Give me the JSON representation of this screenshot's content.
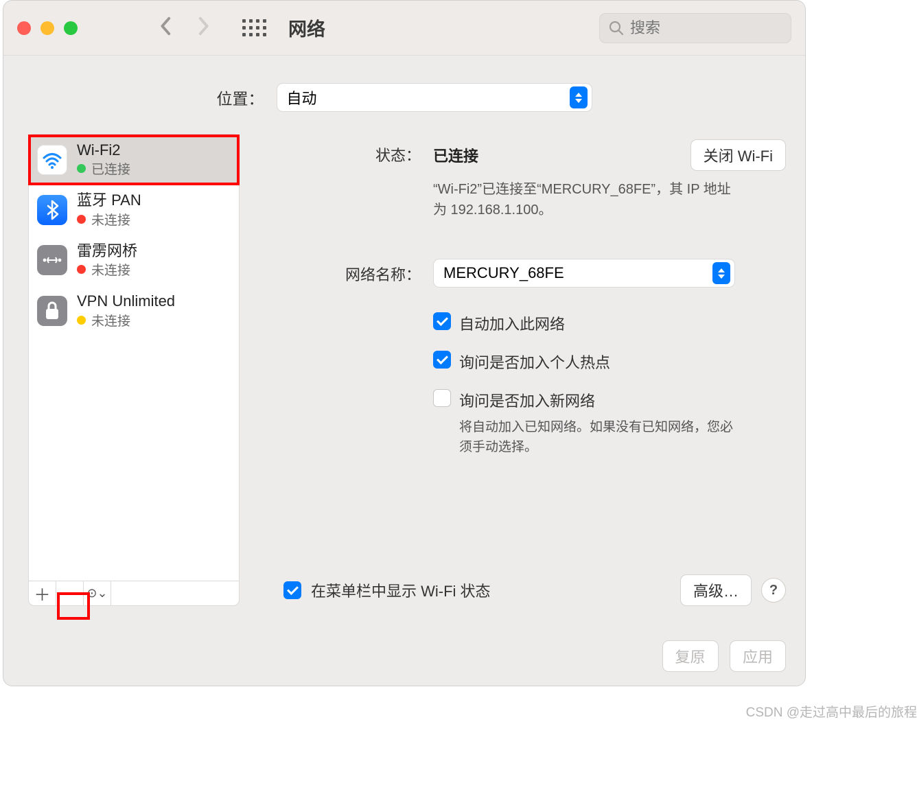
{
  "title": "网络",
  "search_placeholder": "搜索",
  "location_label": "位置：",
  "location_value": "自动",
  "sidebar": {
    "items": [
      {
        "name": "Wi-Fi2",
        "status": "已连接",
        "dot": "green"
      },
      {
        "name": "蓝牙 PAN",
        "status": "未连接",
        "dot": "red"
      },
      {
        "name": "雷雳网桥",
        "status": "未连接",
        "dot": "red"
      },
      {
        "name": "VPN Unlimited",
        "status": "未连接",
        "dot": "yellow"
      }
    ]
  },
  "detail": {
    "status_label": "状态：",
    "status_value": "已连接",
    "turn_off_btn": "关闭 Wi-Fi",
    "status_desc": "“Wi-Fi2”已连接至“MERCURY_68FE”，其 IP 地址为 192.168.1.100。",
    "network_name_label": "网络名称：",
    "network_name_value": "MERCURY_68FE",
    "chk_auto_join": "自动加入此网络",
    "chk_ask_hotspot": "询问是否加入个人热点",
    "chk_ask_new": "询问是否加入新网络",
    "new_net_hint": "将自动加入已知网络。如果没有已知网络，您必须手动选择。",
    "show_menubar": "在菜单栏中显示 Wi-Fi 状态",
    "advanced_btn": "高级…",
    "help": "?"
  },
  "footer": {
    "revert": "复原",
    "apply": "应用"
  },
  "watermark": "CSDN @走过高中最后的旅程"
}
